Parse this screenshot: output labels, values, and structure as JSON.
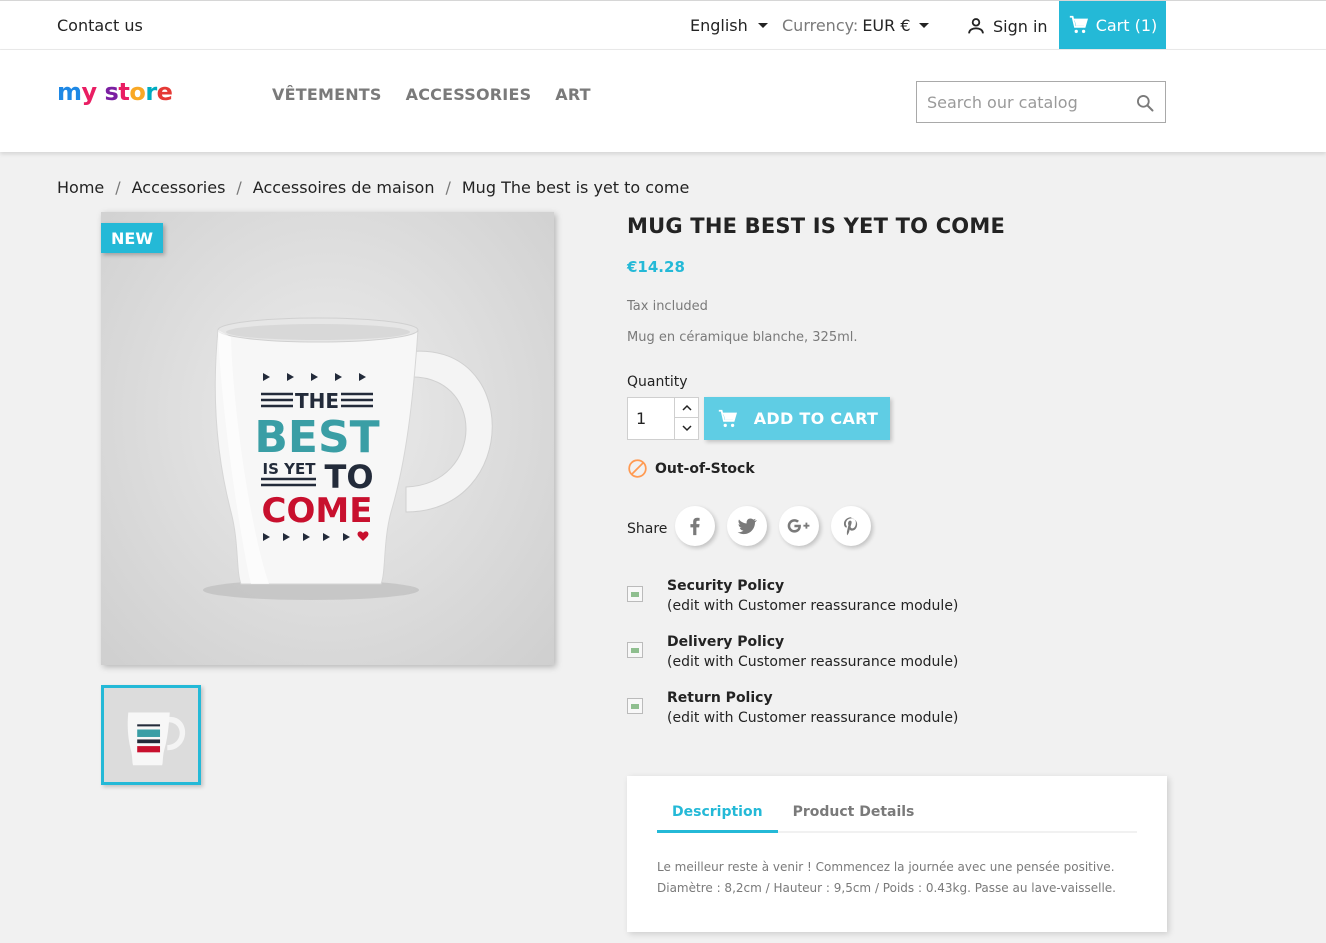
{
  "topbar": {
    "contact": "Contact us",
    "language": "English",
    "currency_label": "Currency:",
    "currency_value": "EUR €",
    "signin": "Sign in",
    "cart": "Cart (1)"
  },
  "header": {
    "logo_letters": [
      "m",
      "y",
      " ",
      "s",
      "t",
      "o",
      "r",
      "e"
    ],
    "logo_colors": [
      "#1e88e5",
      "#e91e63",
      "",
      "#7b1fa2",
      "#e91e63",
      "#f9a825",
      "#00acc1",
      "#e53935"
    ],
    "menu": [
      "VÊTEMENTS",
      "ACCESSORIES",
      "ART"
    ],
    "search_placeholder": "Search our catalog"
  },
  "breadcrumb": [
    "Home",
    "Accessories",
    "Accessoires de maison",
    "Mug The best is yet to come"
  ],
  "product": {
    "badge": "NEW",
    "title": "MUG THE BEST IS YET TO COME",
    "price": "€14.28",
    "tax": "Tax included",
    "short_description": "Mug en céramique blanche, 325ml.",
    "quantity_label": "Quantity",
    "quantity": "1",
    "add_to_cart": "ADD TO CART",
    "stock": "Out-of-Stock",
    "share_label": "Share",
    "mug_print": {
      "line1": "THE",
      "line2": "BEST",
      "line3a": "IS YET",
      "line3b": "TO",
      "line4": "COME"
    }
  },
  "reassurance": [
    {
      "title": "Security Policy",
      "subtitle": "(edit with Customer reassurance module)"
    },
    {
      "title": "Delivery Policy",
      "subtitle": "(edit with Customer reassurance module)"
    },
    {
      "title": "Return Policy",
      "subtitle": "(edit with Customer reassurance module)"
    }
  ],
  "tabs": {
    "items": [
      "Description",
      "Product Details"
    ],
    "active": "Description",
    "description_line1": "Le meilleur reste à venir ! Commencez la journée avec une pensée positive.",
    "description_line2": "Diamètre : 8,2cm / Hauteur : 9,5cm / Poids : 0.43kg. Passe au lave-vaisselle."
  },
  "colors": {
    "accent": "#24b9d7",
    "button": "#5fcde4",
    "out_of_stock": "#ff9a52",
    "mug_teal": "#3a9ea5",
    "mug_red": "#c8102e",
    "mug_dark": "#232b3a"
  }
}
